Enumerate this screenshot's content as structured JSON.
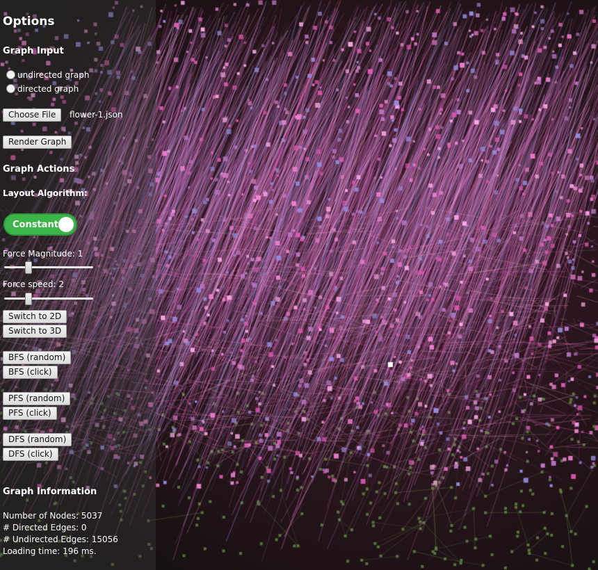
{
  "panel": {
    "title": "Options",
    "graph_input": {
      "heading": "Graph Input",
      "radio_undirected": "undirected graph",
      "radio_directed": "directed graph",
      "choose_file_label": "Choose File",
      "file_name": "flower-1.json",
      "render_label": "Render Graph"
    },
    "graph_actions": {
      "heading": "Graph Actions",
      "layout_label": "Layout Algorithm:",
      "layout_toggle": "Constant",
      "force_magnitude_label": "Force Magnitude: 1",
      "force_magnitude_value": 1,
      "force_speed_label": "Force speed: 2",
      "force_speed_value": 2,
      "switch_2d": "Switch to 2D",
      "switch_3d": "Switch to 3D",
      "bfs_random": "BFS (random)",
      "bfs_click": "BFS (click)",
      "pfs_random": "PFS (random)",
      "pfs_click": "PFS (click)",
      "dfs_random": "DFS (random)",
      "dfs_click": "DFS (click)"
    },
    "graph_info": {
      "heading": "Graph Information",
      "nodes": "Number of Nodes: 5037",
      "directed_edges": "# Directed Edges: 0",
      "undirected_edges": "# Undirected Edges: 15056",
      "loading_time": "Loading time: 196 ms."
    }
  },
  "colors": {
    "background": "#1a1616",
    "pink_edge": "#f07ad0",
    "magenta_node": "#e0409a",
    "green_edge": "#5a8a3a",
    "toggle_green": "#3cb44a"
  }
}
